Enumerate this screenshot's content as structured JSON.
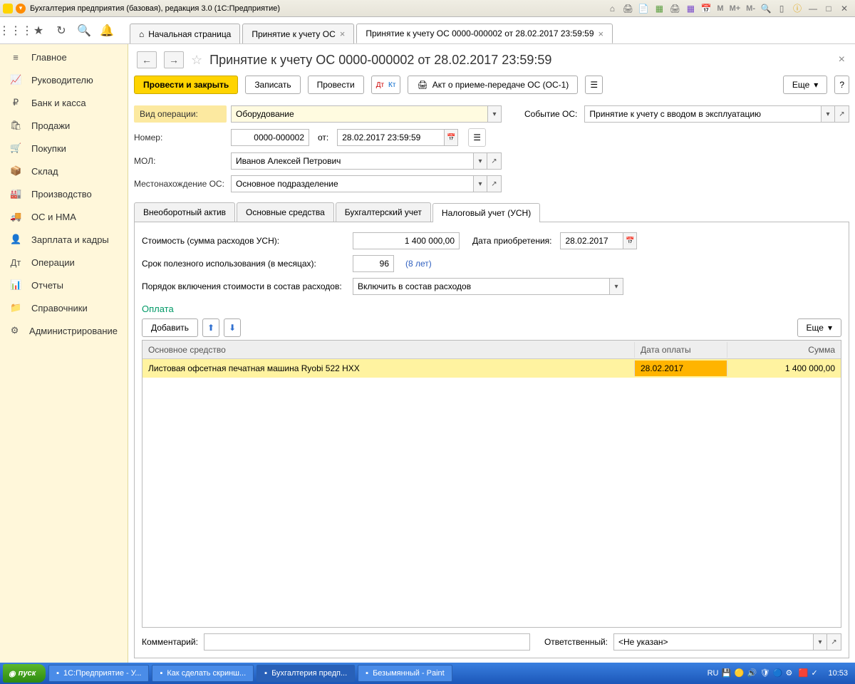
{
  "window": {
    "title": "Бухгалтерия предприятия (базовая), редакция 3.0  (1С:Предприятие)"
  },
  "tabs": {
    "home": "Начальная страница",
    "tab2": "Принятие к учету ОС",
    "tab3": "Принятие к учету ОС 0000-000002 от 28.02.2017 23:59:59"
  },
  "sidebar": [
    {
      "icon": "≡",
      "label": "Главное"
    },
    {
      "icon": "📈",
      "label": "Руководителю"
    },
    {
      "icon": "₽",
      "label": "Банк и касса"
    },
    {
      "icon": "🛍",
      "label": "Продажи"
    },
    {
      "icon": "🛒",
      "label": "Покупки"
    },
    {
      "icon": "📦",
      "label": "Склад"
    },
    {
      "icon": "🏭",
      "label": "Производство"
    },
    {
      "icon": "🚚",
      "label": "ОС и НМА"
    },
    {
      "icon": "👤",
      "label": "Зарплата и кадры"
    },
    {
      "icon": "Дт",
      "label": "Операции"
    },
    {
      "icon": "📊",
      "label": "Отчеты"
    },
    {
      "icon": "📁",
      "label": "Справочники"
    },
    {
      "icon": "⚙",
      "label": "Администрирование"
    }
  ],
  "doc": {
    "title": "Принятие к учету ОС 0000-000002 от 28.02.2017 23:59:59",
    "actions": {
      "post_close": "Провести и закрыть",
      "write": "Записать",
      "post": "Провести",
      "act": "Акт о приеме-передаче ОС (ОС-1)",
      "more": "Еще"
    },
    "fields": {
      "op_label": "Вид операции:",
      "op_value": "Оборудование",
      "event_label": "Событие ОС:",
      "event_value": "Принятие к учету с вводом в эксплуатацию",
      "num_label": "Номер:",
      "num_value": "0000-000002",
      "from_label": "от:",
      "date_value": "28.02.2017 23:59:59",
      "mol_label": "МОЛ:",
      "mol_value": "Иванов Алексей Петрович",
      "loc_label": "Местонахождение ОС:",
      "loc_value": "Основное подразделение"
    },
    "inner_tabs": [
      "Внеоборотный актив",
      "Основные средства",
      "Бухгалтерский учет",
      "Налоговый учет (УСН)"
    ],
    "usn": {
      "cost_label": "Стоимость (сумма расходов УСН):",
      "cost_value": "1 400 000,00",
      "acq_label": "Дата приобретения:",
      "acq_value": "28.02.2017",
      "life_label": "Срок полезного использования (в месяцах):",
      "life_value": "96",
      "life_hint": "(8 лет)",
      "order_label": "Порядок включения стоимости в состав расходов:",
      "order_value": "Включить в состав расходов",
      "section": "Оплата",
      "add": "Добавить",
      "more": "Еще"
    },
    "table": {
      "h1": "Основное средство",
      "h2": "Дата оплаты",
      "h3": "Сумма",
      "rows": [
        {
          "asset": "Листовая офсетная печатная машина Ryobi 522 HXX",
          "date": "28.02.2017",
          "sum": "1 400 000,00"
        }
      ]
    },
    "footer": {
      "comment_label": "Комментарий:",
      "comment_value": "",
      "resp_label": "Ответственный:",
      "resp_value": "<Не указан>"
    }
  },
  "taskbar": {
    "start": "пуск",
    "items": [
      "1С:Предприятие - У...",
      "Как сделать скринш...",
      "Бухгалтерия предп...",
      "Безымянный - Paint"
    ],
    "lang": "RU",
    "time": "10:53"
  }
}
